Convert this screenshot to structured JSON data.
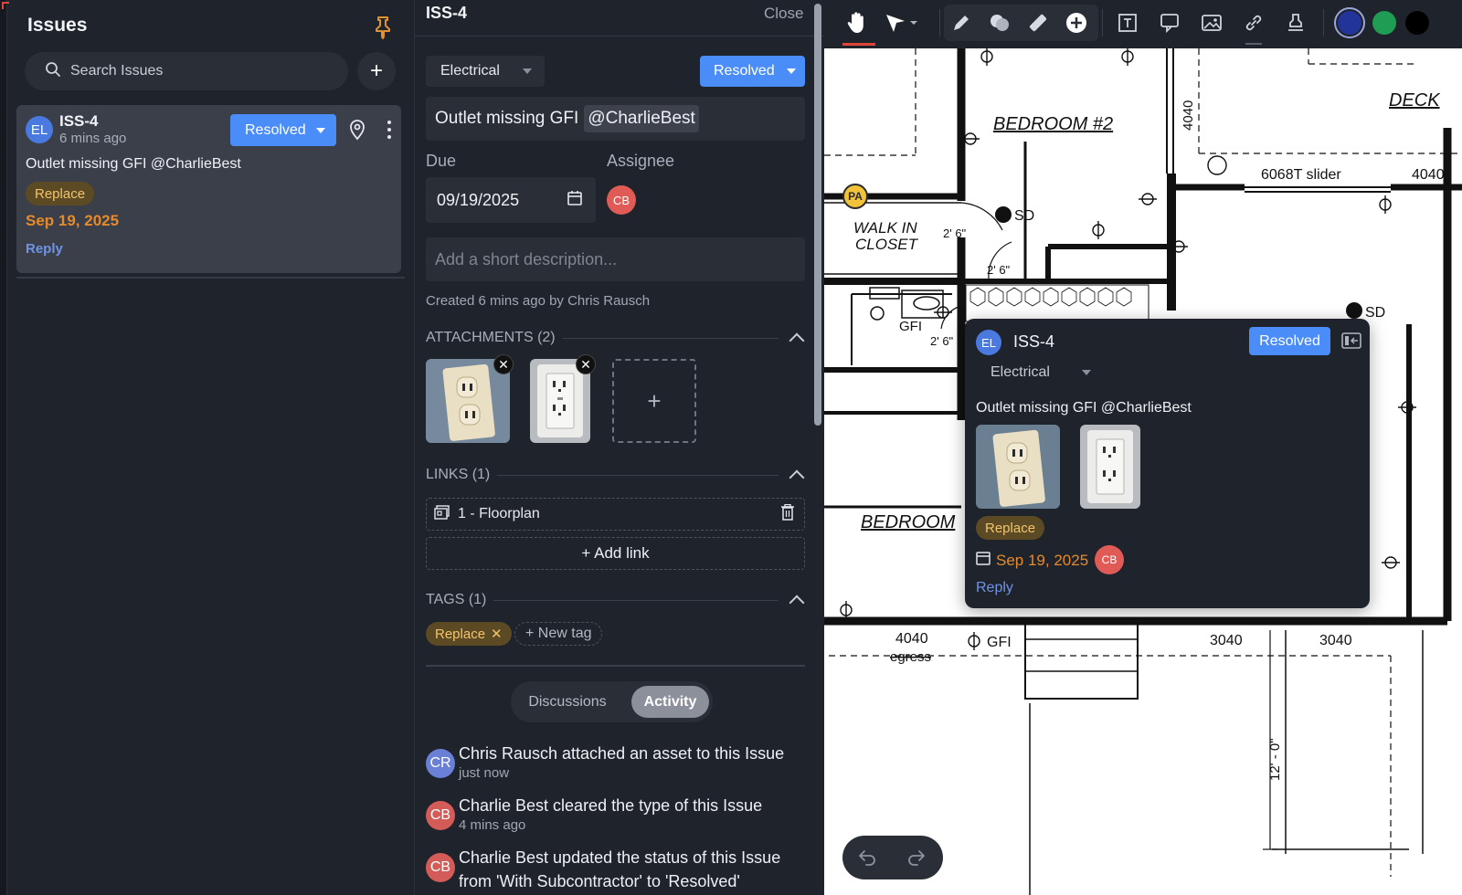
{
  "left_panel": {
    "title": "Issues",
    "search_placeholder": "Search Issues",
    "add_label": "+",
    "card": {
      "avatar": "EL",
      "id": "ISS-4",
      "time": "6 mins ago",
      "status": "Resolved",
      "title": "Outlet missing GFI @CharlieBest",
      "tag": "Replace",
      "due": "Sep 19, 2025",
      "reply": "Reply"
    }
  },
  "detail": {
    "id": "ISS-4",
    "close": "Close",
    "type": "Electrical",
    "status": "Resolved",
    "title_text": "Outlet missing GFI",
    "title_mention": "@CharlieBest",
    "due_label": "Due",
    "due_value": "09/19/2025",
    "assignee_label": "Assignee",
    "assignee_initials": "CB",
    "description_placeholder": "Add a short description...",
    "created": "Created 6 mins ago by Chris Rausch",
    "attachments_label": "ATTACHMENTS (2)",
    "links_label": "LINKS (1)",
    "link_item": "1 - Floorplan",
    "add_link": "+ Add link",
    "tags_label": "TAGS (1)",
    "tag": "Replace",
    "new_tag": "+ New tag",
    "tab_discussions": "Discussions",
    "tab_activity": "Activity",
    "activity": [
      {
        "initials": "CR",
        "color": "#6a7fd6",
        "text": "Chris Rausch attached an asset to this Issue",
        "when": "just now"
      },
      {
        "initials": "CB",
        "color": "#d35b58",
        "text": "Charlie Best cleared the type of this Issue",
        "when": "4 mins ago"
      },
      {
        "initials": "CB",
        "color": "#d35b58",
        "text": "Charlie Best updated the status of this Issue",
        "text2": "from 'With Subcontractor' to 'Resolved'"
      }
    ]
  },
  "drawing": {
    "labels": {
      "bedroom2": "BEDROOM #2",
      "deck": "DECK",
      "walkin1": "WALK IN",
      "walkin2": "CLOSET",
      "slider": "6068T slider",
      "sd": "SD",
      "sd2": "SD",
      "dim26a": "2' 6\"",
      "dim26b": "2' 6\"",
      "dim26c": "2' 6\"",
      "gfi": "GFI",
      "gfi2": "GFI",
      "bedroom": "BEDROOM",
      "v4040": "4040",
      "r4040": "4040",
      "b4040": "4040",
      "egress": "egress",
      "b3040a": "3040",
      "b3040b": "3040",
      "dim12": "12' - 0\""
    },
    "marker": "PA"
  },
  "popup": {
    "avatar": "EL",
    "id": "ISS-4",
    "status": "Resolved",
    "type": "Electrical",
    "title": "Outlet missing GFI @CharlieBest",
    "tag": "Replace",
    "due": "Sep 19, 2025",
    "assignee": "CB",
    "reply": "Reply"
  },
  "toolbar": {
    "icons": [
      "hand-icon",
      "select-arrow-icon",
      "pencil-icon",
      "shapes-icon",
      "ruler-icon",
      "add-issue-icon",
      "text-box-icon",
      "callout-icon",
      "image-icon",
      "link-icon",
      "stamp-icon",
      "color-navy-icon",
      "color-green-icon",
      "color-black-icon"
    ],
    "colors": {
      "navy": "#22349a",
      "green": "#1f9d55",
      "black": "#000000"
    }
  },
  "colors": {
    "accent_blue": "#4b8df8",
    "date_orange": "#e58a2c",
    "tag_bg": "#5c4a25",
    "tag_text": "#f2c46a"
  }
}
